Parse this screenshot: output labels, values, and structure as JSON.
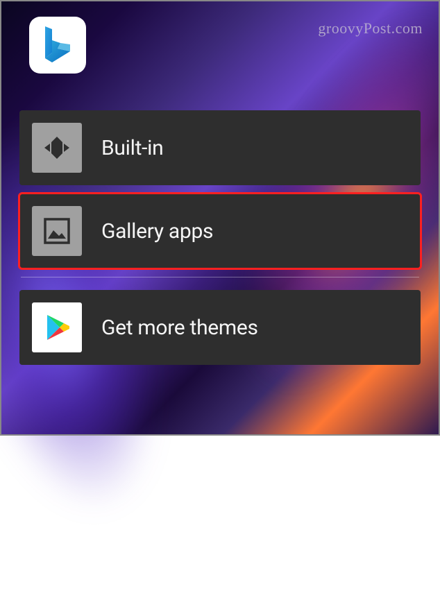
{
  "watermark": "groovyPost.com",
  "app_icon": "bing-icon",
  "menu": {
    "items": [
      {
        "label": "Built-in",
        "icon": "built-in-icon",
        "highlighted": false
      },
      {
        "label": "Gallery apps",
        "icon": "gallery-icon",
        "highlighted": true
      },
      {
        "label": "Get more themes",
        "icon": "play-store-icon",
        "highlighted": false
      }
    ]
  }
}
